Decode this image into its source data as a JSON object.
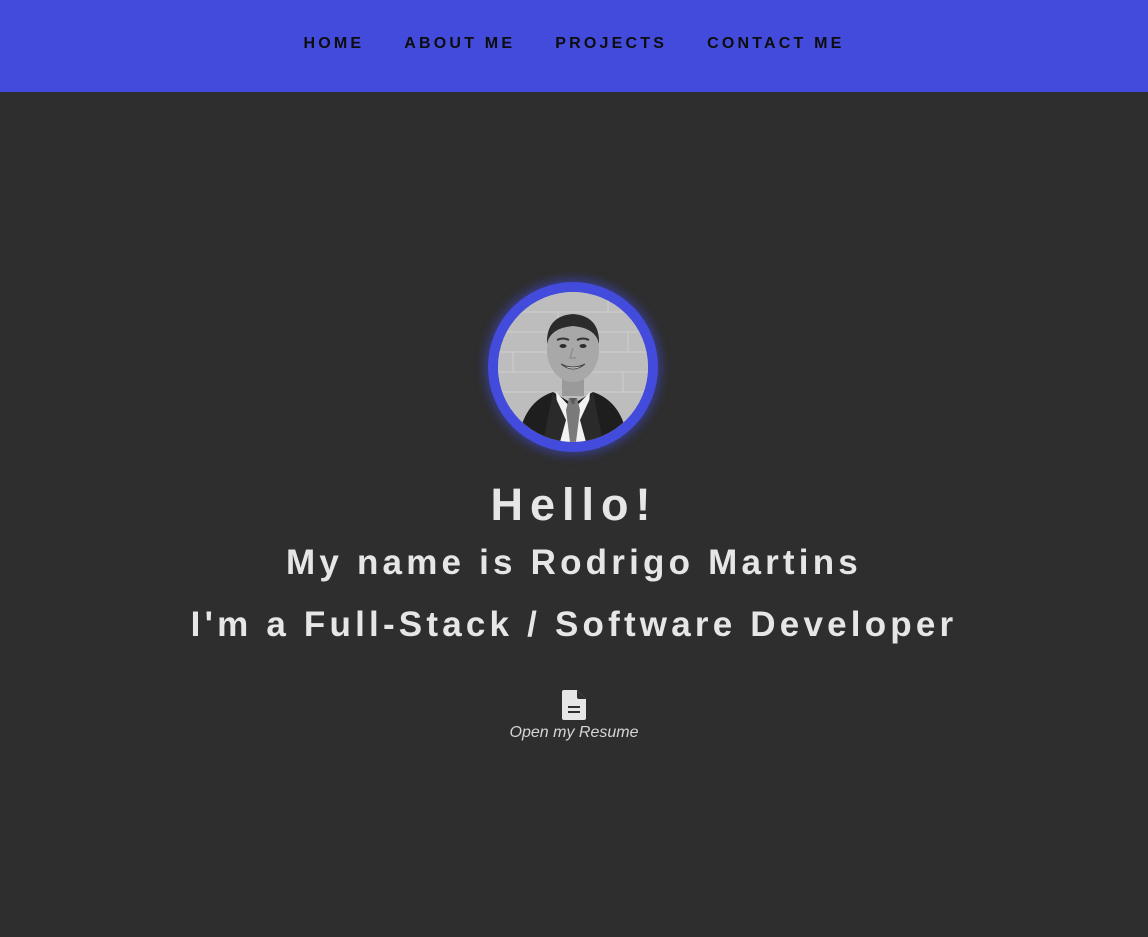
{
  "nav": {
    "items": [
      {
        "label": "HOME"
      },
      {
        "label": "ABOUT ME"
      },
      {
        "label": "PROJECTS"
      },
      {
        "label": "CONTACT ME"
      }
    ]
  },
  "hero": {
    "greeting": "Hello!",
    "name_line": "My name is Rodrigo Martins",
    "role_line": "I'm a Full-Stack / Software Developer",
    "resume": {
      "icon": "document-icon",
      "label": "Open my Resume"
    },
    "avatar": {
      "icon": "profile-photo"
    }
  },
  "colors": {
    "accent": "#424bdb",
    "background": "#2e2e2e",
    "text": "#e6e6e6"
  }
}
